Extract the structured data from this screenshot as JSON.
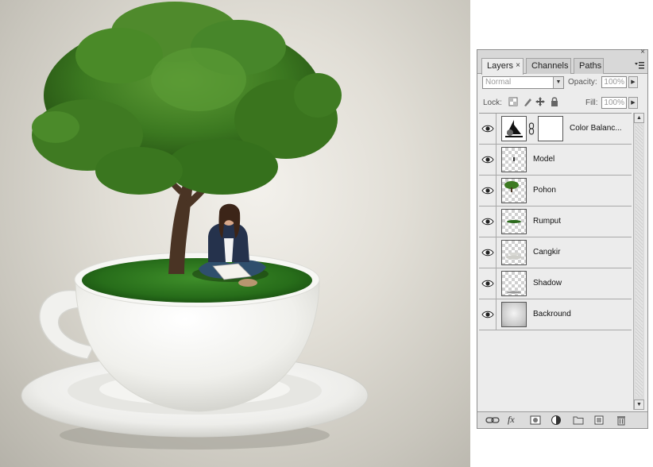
{
  "panel": {
    "tabs": [
      {
        "label": "Layers",
        "active": true,
        "close": "×"
      },
      {
        "label": "Channels",
        "active": false
      },
      {
        "label": "Paths",
        "active": false
      }
    ],
    "close_symbol": "×",
    "blend_mode": "Normal",
    "opacity_label": "Opacity:",
    "opacity_value": "100%",
    "lock_label": "Lock:",
    "fill_label": "Fill:",
    "fill_value": "100%",
    "arrow_symbol": "▶",
    "dropdown_symbol": "▼",
    "scroll_up": "▲",
    "scroll_down": "▼"
  },
  "layers": [
    {
      "name": "Color Balanc...",
      "visible": true,
      "type": "adjustment",
      "thumb_icon": "color-balance-icon",
      "has_mask": true
    },
    {
      "name": "Model",
      "visible": true,
      "type": "pixel",
      "thumb_icon": "model-thumbnail"
    },
    {
      "name": "Pohon",
      "visible": true,
      "type": "pixel",
      "thumb_icon": "tree-thumbnail"
    },
    {
      "name": "Rumput",
      "visible": true,
      "type": "pixel",
      "thumb_icon": "grass-thumbnail"
    },
    {
      "name": "Cangkir",
      "visible": true,
      "type": "pixel",
      "thumb_icon": "cup-thumbnail"
    },
    {
      "name": "Shadow",
      "visible": true,
      "type": "pixel",
      "thumb_icon": "shadow-thumbnail"
    },
    {
      "name": "Backround",
      "visible": true,
      "type": "pixel",
      "thumb_icon": "gradient-thumbnail"
    }
  ],
  "toolbar_icons": [
    "link-layers-icon",
    "fx-icon",
    "add-mask-icon",
    "adjustment-layer-icon",
    "new-group-icon",
    "new-layer-icon",
    "trash-icon"
  ],
  "toolbar_fx_label": "fx",
  "colors": {
    "panel_bg": "#ececec",
    "tab_bg": "#d8d8d8",
    "grass": "#2f7a1f",
    "foliage": "#3d7d22",
    "cup": "#f2f2ef"
  }
}
